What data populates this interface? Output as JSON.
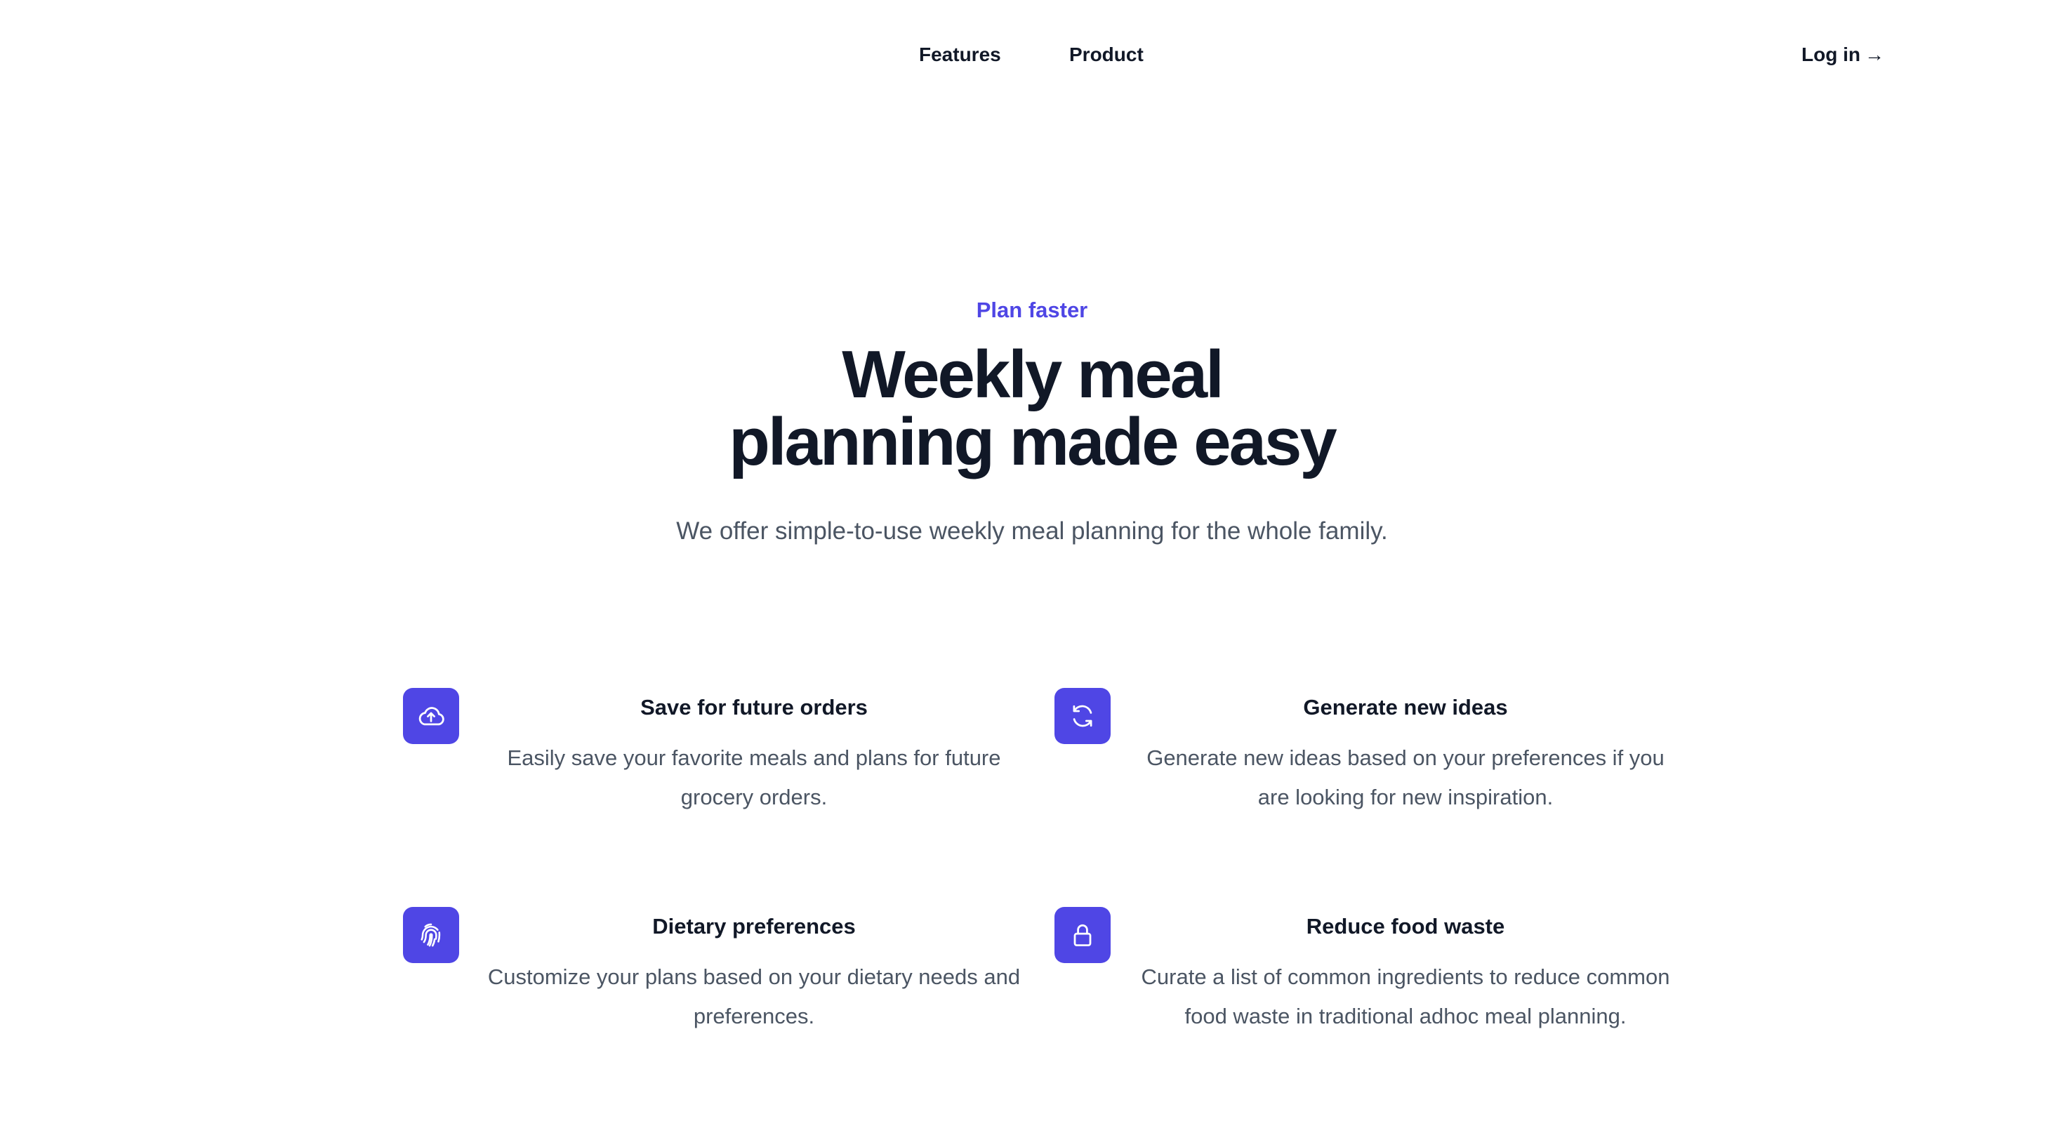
{
  "nav": {
    "links": [
      {
        "label": "Features"
      },
      {
        "label": "Product"
      }
    ],
    "login_label": "Log in",
    "login_arrow": "→"
  },
  "hero": {
    "eyebrow": "Plan faster",
    "headline_line1": "Weekly meal",
    "headline_line2": "planning made easy",
    "subhead": "We offer simple-to-use weekly meal planning for the whole family."
  },
  "features": [
    {
      "icon": "cloud-upload-icon",
      "title": "Save for future orders",
      "description": "Easily save your favorite meals and plans for future grocery orders."
    },
    {
      "icon": "refresh-icon",
      "title": "Generate new ideas",
      "description": "Generate new ideas based on your preferences if you are looking for new inspiration."
    },
    {
      "icon": "fingerprint-icon",
      "title": "Dietary preferences",
      "description": "Customize your plans based on your dietary needs and preferences."
    },
    {
      "icon": "lock-icon",
      "title": "Reduce food waste",
      "description": "Curate a list of common ingredients to reduce common food waste in traditional adhoc meal planning."
    }
  ],
  "colors": {
    "accent": "#4f46e5",
    "heading": "#111827",
    "body_text": "#4b5563",
    "background": "#ffffff"
  }
}
